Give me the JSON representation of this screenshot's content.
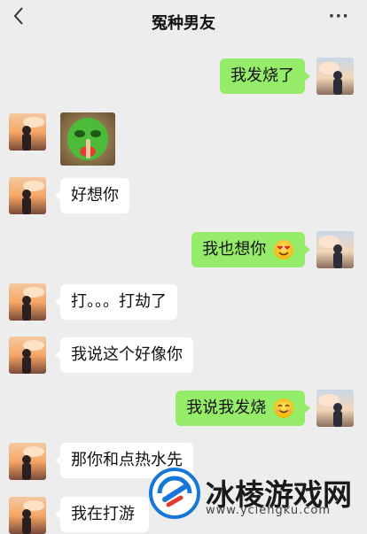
{
  "header": {
    "title": "冤种男友",
    "back_icon": "chevron-left-icon",
    "more_label": "···"
  },
  "messages": [
    {
      "side": "me",
      "text": "我发烧了"
    },
    {
      "side": "other",
      "type": "sticker",
      "sticker": "green-mask-sticker"
    },
    {
      "side": "other",
      "text": "好想你"
    },
    {
      "side": "me",
      "text": "我也想你",
      "emoji": "heart-eyes-emoji"
    },
    {
      "side": "other",
      "text": "打。。。打劫了"
    },
    {
      "side": "other",
      "text": "我说这个好像你"
    },
    {
      "side": "me",
      "text": "我说我发烧",
      "emoji": "smile-emoji"
    },
    {
      "side": "other",
      "text": "那你和点热水先"
    },
    {
      "side": "other",
      "text": "我在打游"
    }
  ],
  "watermark": {
    "text": "冰棱游戏网",
    "url": "www.yclengku.com"
  },
  "colors": {
    "bg": "#ededed",
    "me_bubble": "#95ec69",
    "other_bubble": "#ffffff",
    "watermark_blue": "#1677d8"
  }
}
